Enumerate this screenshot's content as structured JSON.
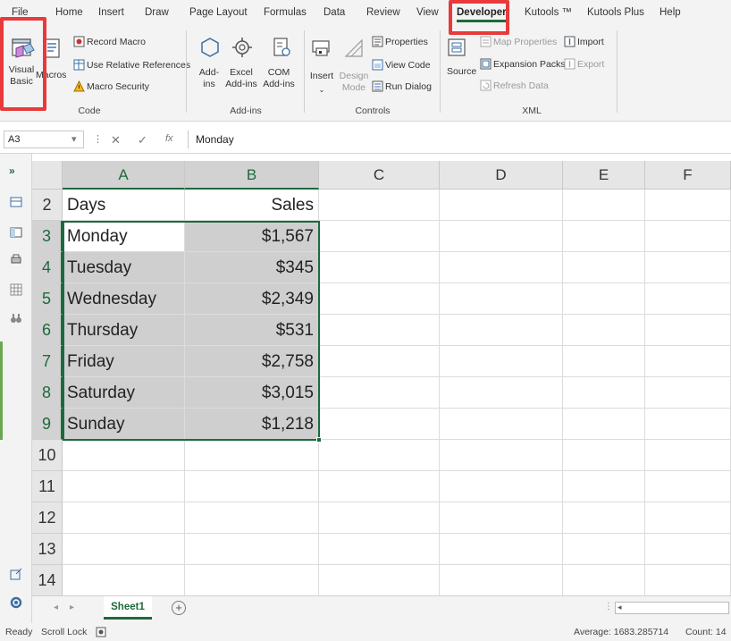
{
  "ribbon_tabs": [
    "File",
    "Home",
    "Insert",
    "Draw",
    "Page Layout",
    "Formulas",
    "Data",
    "Review",
    "View",
    "Developer",
    "Kutools ™",
    "Kutools Plus",
    "Help"
  ],
  "code_group": {
    "visual_basic_line1": "Visual",
    "visual_basic_line2": "Basic",
    "macros": "Macros",
    "record_macro": "Record Macro",
    "use_relative_references": "Use Relative References",
    "macro_security": "Macro Security",
    "label": "Code"
  },
  "addins_group": {
    "addins_line1": "Add-",
    "addins_line2": "ins",
    "excel_addins_line1": "Excel",
    "excel_addins_line2": "Add-ins",
    "com_addins_line1": "COM",
    "com_addins_line2": "Add-ins",
    "label": "Add-ins"
  },
  "controls_group": {
    "insert": "Insert",
    "design_mode_line1": "Design",
    "design_mode_line2": "Mode",
    "properties": "Properties",
    "view_code": "View Code",
    "run_dialog": "Run Dialog",
    "label": "Controls"
  },
  "xml_group": {
    "source": "Source",
    "map_properties": "Map Properties",
    "expansion_packs": "Expansion Packs",
    "refresh_data": "Refresh Data",
    "import": "Import",
    "export": "Export",
    "label": "XML"
  },
  "formula_bar": {
    "name_box": "A3",
    "fx": "fx",
    "content": "Monday"
  },
  "grid": {
    "columns": [
      "A",
      "B",
      "C",
      "D",
      "E",
      "F"
    ],
    "rows": [
      {
        "num": "2",
        "a": "Days",
        "b": "Sales"
      },
      {
        "num": "3",
        "a": "Monday",
        "b": "$1,567"
      },
      {
        "num": "4",
        "a": "Tuesday",
        "b": "$345"
      },
      {
        "num": "5",
        "a": "Wednesday",
        "b": "$2,349"
      },
      {
        "num": "6",
        "a": "Thursday",
        "b": "$531"
      },
      {
        "num": "7",
        "a": "Friday",
        "b": "$2,758"
      },
      {
        "num": "8",
        "a": "Saturday",
        "b": "$3,015"
      },
      {
        "num": "9",
        "a": "Sunday",
        "b": "$1,218"
      },
      {
        "num": "10",
        "a": "",
        "b": ""
      },
      {
        "num": "11",
        "a": "",
        "b": ""
      },
      {
        "num": "12",
        "a": "",
        "b": ""
      },
      {
        "num": "13",
        "a": "",
        "b": ""
      },
      {
        "num": "14",
        "a": "",
        "b": ""
      }
    ]
  },
  "sheet_tabs": {
    "active": "Sheet1",
    "add": "+"
  },
  "status_bar": {
    "ready": "Ready",
    "scroll_lock": "Scroll Lock",
    "average": "Average: 1683.285714",
    "count": "Count: 14"
  },
  "left_toolbar_icons": [
    "expand-icon",
    "table-icon",
    "header-icon",
    "print-icon",
    "grid-icon",
    "binoculars-icon",
    "popout-icon",
    "settings-icon"
  ],
  "colors": {
    "accent": "#1d6a3c",
    "highlight": "#e83a3a",
    "selection_fill": "#cfcfcf"
  }
}
